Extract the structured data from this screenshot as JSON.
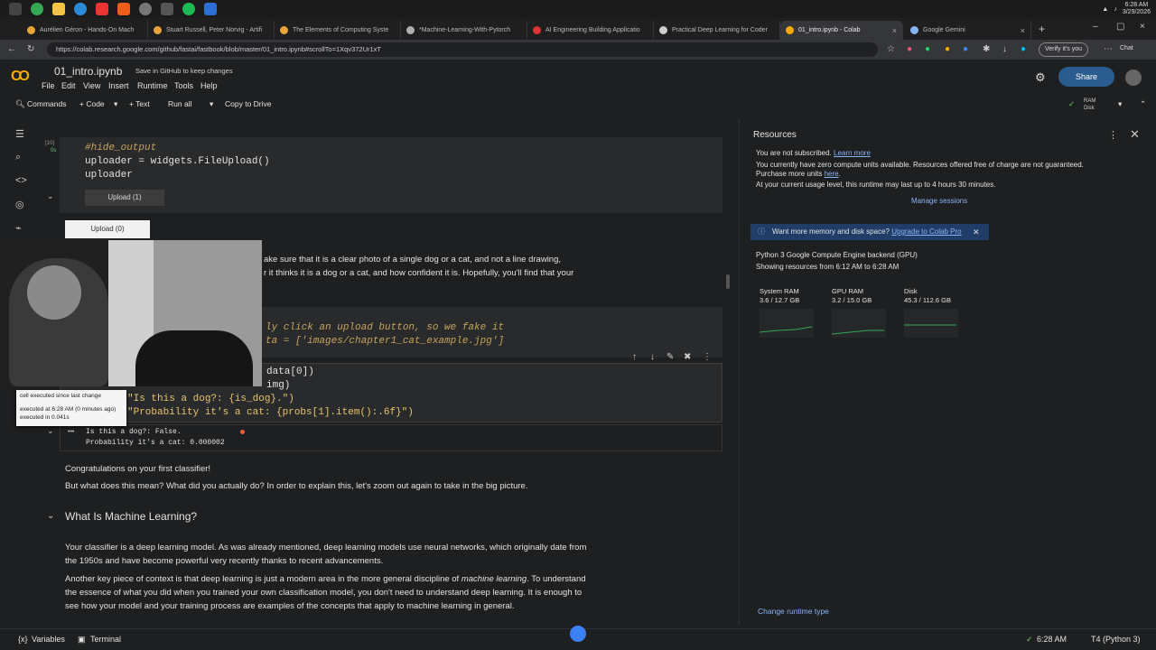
{
  "taskbar": {
    "date": "3/29/2026",
    "time": "6:28 AM"
  },
  "tabs": [
    {
      "title": "Aurélien Géron - Hands-On Mach",
      "color": "#e8a43a"
    },
    {
      "title": "Stuart Russell, Peter Norvig - Artifi",
      "color": "#e8a43a"
    },
    {
      "title": "The Elements of Computing Syste",
      "color": "#e8a43a"
    },
    {
      "title": "*Machine-Learning-With-Pytorch",
      "color": "#b0b0b0"
    },
    {
      "title": "AI Engineering Building Applicatio",
      "color": "#d33"
    },
    {
      "title": "Practical Deep Learning for Coder",
      "color": "#ccc"
    },
    {
      "title": "01_intro.ipynb - Colab",
      "color": "#f9ab00"
    },
    {
      "title": "Google Gemini",
      "color": "#8ab4f8"
    }
  ],
  "address": {
    "url": "https://colab.research.google.com/github/fastai/fastbook/blob/master/01_intro.ipynb#scrollTo=1Xqv372Ur1xT",
    "verify": "Verify it's you",
    "chat": "Chat"
  },
  "header": {
    "title": "01_intro.ipynb",
    "save_github": "Save in GitHub to keep changes",
    "menus": [
      "File",
      "Edit",
      "View",
      "Insert",
      "Runtime",
      "Tools",
      "Help"
    ],
    "share": "Share"
  },
  "toolbar": {
    "commands": "Commands",
    "code": "+ Code",
    "text": "+ Text",
    "run_all": "Run all",
    "copy_drive": "Copy to Drive",
    "ram": "RAM",
    "disk": "Disk"
  },
  "cells": {
    "cell1_count": "[10]",
    "cell1_time": "0s",
    "cell1_line1": "#hide_output",
    "cell1_line2": "uploader = widgets.FileUpload()",
    "cell1_line3": "uploader",
    "upload1": "Upload (1)",
    "upload0": "Upload (0)",
    "md_line1": "ake sure that it is a clear photo of a single dog or a cat, and not a line drawing,",
    "md_line2": "r it thinks it is a dog or a cat, and how confident it is. Hopefully, you'll find that your",
    "cell2_line1": "ly click an upload button, so we fake it",
    "cell2_line2": "ta = ['images/chapter1_cat_example.jpg']",
    "cell3_line1": "data[0])",
    "cell3_line2": "img)",
    "cell3_line3": "\"Is this a dog?: {is_dog}.\")",
    "cell3_line4": "\"Probability it's a cat: {probs[1].item():.6f}\")",
    "output1": "Is this a dog?: False.",
    "output2": "Probability it's a cat: 0.000002",
    "output_ellipsis": "•••"
  },
  "tooltip": {
    "line1": "cell executed since last change",
    "line2": "executed at 6:28 AM (0 minutes ago)",
    "line3": "executed in 0.041s"
  },
  "markdown": {
    "congrats": "Congratulations on your first classifier!",
    "what_mean": "But what does this mean? What did you actually do? In order to explain this, let's zoom out again to take in the big picture.",
    "heading": "What Is Machine Learning?",
    "p1": "Your classifier is a deep learning model. As was already mentioned, deep learning models use neural networks, which originally date from the 1950s and have become powerful very recently thanks to recent advancements.",
    "p2_pre": "Another key piece of context is that deep learning is just a modern area in the more general discipline of ",
    "p2_em": "machine learning",
    "p2_post": ". To understand the essence of what you did when you trained your own classification model, you don't need to understand deep learning. It is enough to see how your model and your training process are examples of the concepts that apply to machine learning in general."
  },
  "resources": {
    "title": "Resources",
    "not_subscribed": "You are not subscribed.",
    "learn_more": "Learn more",
    "compute_units": "You currently have zero compute units available. Resources offered free of charge are not guaranteed.",
    "purchase": "Purchase more units",
    "here": "here",
    "usage": "At your current usage level, this runtime may last up to 4 hours 30 minutes.",
    "manage": "Manage sessions",
    "banner_pre": "Want more memory and disk space?",
    "banner_link": "Upgrade to Colab Pro",
    "backend": "Python 3 Google Compute Engine backend (GPU)",
    "showing": "Showing resources from 6:12 AM to 6:28 AM",
    "gauges": [
      {
        "label": "System RAM",
        "value": "3.6 / 12.7 GB"
      },
      {
        "label": "GPU RAM",
        "value": "3.2 / 15.0 GB"
      },
      {
        "label": "Disk",
        "value": "45.3 / 112.6 GB"
      }
    ],
    "change_runtime": "Change runtime type"
  },
  "statusbar": {
    "variables": "Variables",
    "terminal": "Terminal",
    "time": "6:28 AM",
    "runtime": "T4 (Python 3)"
  }
}
